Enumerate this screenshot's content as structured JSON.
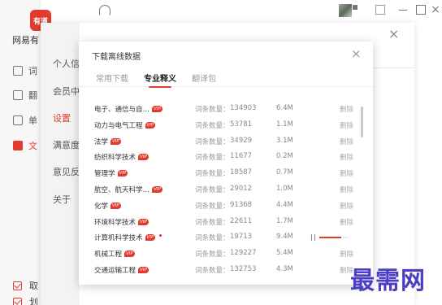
{
  "app": {
    "logo_text": "有道",
    "name": "网易有",
    "sidebar": [
      {
        "label": "词",
        "active": false
      },
      {
        "label": "翻",
        "active": false
      },
      {
        "label": "单",
        "active": false
      },
      {
        "label": "文",
        "active": true
      }
    ],
    "bottom_checks": [
      {
        "label": "取",
        "checked": true
      },
      {
        "label": "划",
        "checked": true
      }
    ]
  },
  "settings": {
    "nav": [
      {
        "label": "个人信息",
        "active": false
      },
      {
        "label": "会员中心",
        "active": false
      },
      {
        "label": "设置",
        "active": true
      },
      {
        "label": "满意度调",
        "active": false
      },
      {
        "label": "意见反馈",
        "active": false
      },
      {
        "label": "关于",
        "active": false
      }
    ],
    "close": "×"
  },
  "dialog": {
    "title": "下载离线数据",
    "close": "×",
    "tabs": [
      {
        "label": "常用下载",
        "active": false
      },
      {
        "label": "专业释义",
        "active": true
      },
      {
        "label": "翻译包",
        "active": false
      }
    ],
    "count_label": "词条数量：",
    "vip_badge": "VIP",
    "delete_label": "删除",
    "rows": [
      {
        "name": "电子、通信与自…",
        "count": "134903",
        "size": "6.4M",
        "status": "delete"
      },
      {
        "name": "动力与电气工程",
        "count": "53781",
        "size": "1.1M",
        "status": "delete"
      },
      {
        "name": "法学",
        "count": "34929",
        "size": "3.1M",
        "status": "delete"
      },
      {
        "name": "纺织科学技术",
        "count": "11677",
        "size": "0.2M",
        "status": "delete"
      },
      {
        "name": "管理学",
        "count": "18587",
        "size": "0.7M",
        "status": "delete"
      },
      {
        "name": "航空、航天科学…",
        "count": "29012",
        "size": "1.0M",
        "status": "delete"
      },
      {
        "name": "化学",
        "count": "91368",
        "size": "4.4M",
        "status": "delete"
      },
      {
        "name": "环境科学技术",
        "count": "22611",
        "size": "1.7M",
        "status": "delete"
      },
      {
        "name": "计算机科学技术",
        "count": "19713",
        "size": "9.4M",
        "status": "downloading",
        "progress": 0.75,
        "new": true
      },
      {
        "name": "机械工程",
        "count": "129227",
        "size": "5.4M",
        "status": "delete"
      },
      {
        "name": "交通运输工程",
        "count": "132753",
        "size": "4.3M",
        "status": "delete"
      }
    ]
  },
  "watermark": "最需网",
  "colors": {
    "accent": "#e23a2e",
    "watermark": "#4a3ec2"
  },
  "icons": [
    "headset-icon",
    "avatar",
    "shrink-icon",
    "minimize-icon",
    "maximize-icon",
    "close-icon",
    "pause-icon"
  ]
}
